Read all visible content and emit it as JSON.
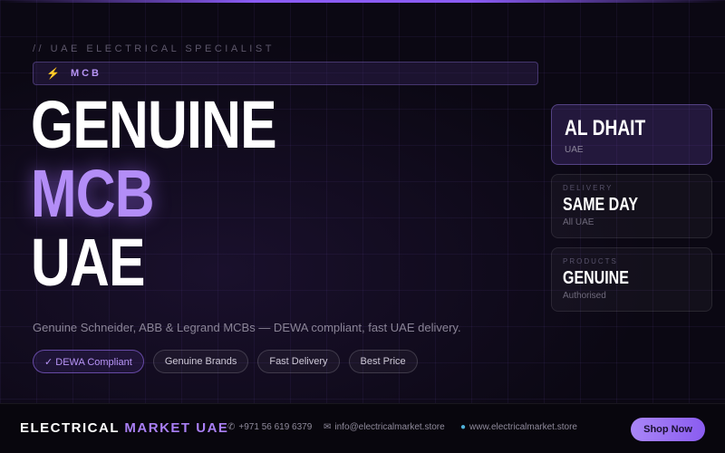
{
  "hero": {
    "kicker": "// UAE ELECTRICAL SPECIALIST",
    "tag_icon": "lightning-bolt-icon",
    "tag_label": "MCB",
    "headline": [
      "GENUINE",
      "MCB",
      "UAE"
    ],
    "subtitle": "Genuine Schneider, ABB & Legrand MCBs — DEWA compliant, fast UAE delivery.",
    "badges": [
      "✓ DEWA Compliant",
      "Genuine Brands",
      "Fast Delivery",
      "Best Price"
    ]
  },
  "cards": [
    {
      "caption": "",
      "value": "AL DHAIT",
      "sub": "UAE"
    },
    {
      "caption": "DELIVERY",
      "value": "SAME DAY",
      "sub": "All UAE"
    },
    {
      "caption": "PRODUCTS",
      "value": "GENUINE",
      "sub": "Authorised"
    }
  ],
  "footer": {
    "brand_main": "ELECTRICAL",
    "brand_accent": "MARKET UAE",
    "phone": "+971 56 619 6379",
    "email": "info@electricalmarket.store",
    "website": "www.electricalmarket.store",
    "cta": "Shop Now"
  },
  "colors": {
    "accent": "#a97ff5",
    "background": "#0b0813"
  }
}
